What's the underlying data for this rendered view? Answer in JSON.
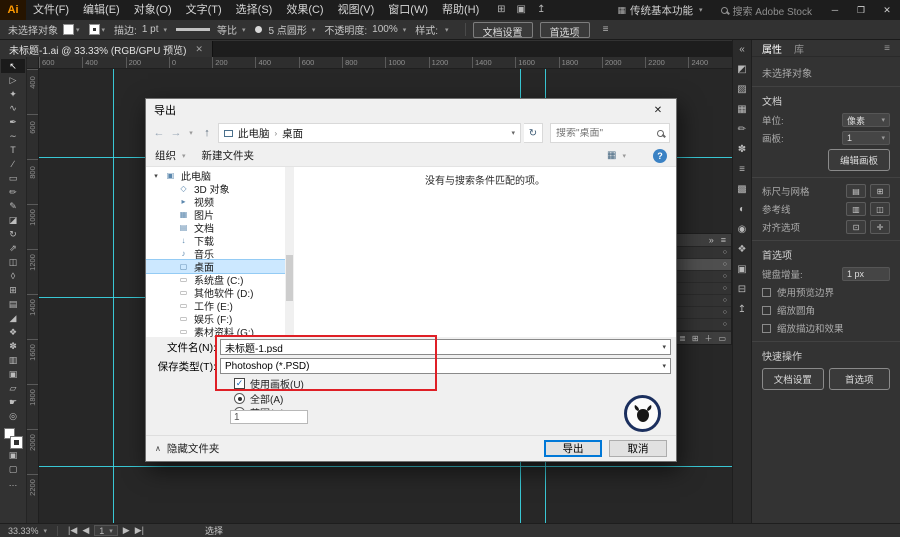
{
  "colors": {
    "accent": "#0078d7",
    "guide": "#3cd9e8",
    "annotation": "#df1f26"
  },
  "glyphs": {
    "caret": "▾",
    "hamburger": "≡",
    "back": "←",
    "forward": "→",
    "up": "↑",
    "refresh": "↻",
    "check": "✓",
    "chevron_up": "∧",
    "twisty": "▾",
    "double_right": "»",
    "circle": "○",
    "close": "✕",
    "question": "?",
    "view": "▦"
  },
  "menubar": {
    "logo": "Ai",
    "items": [
      {
        "name": "menu-file",
        "label": "文件(F)"
      },
      {
        "name": "menu-edit",
        "label": "编辑(E)"
      },
      {
        "name": "menu-object",
        "label": "对象(O)"
      },
      {
        "name": "menu-type",
        "label": "文字(T)"
      },
      {
        "name": "menu-select",
        "label": "选择(S)"
      },
      {
        "name": "menu-effect",
        "label": "效果(C)"
      },
      {
        "name": "menu-view",
        "label": "视图(V)"
      },
      {
        "name": "menu-window",
        "label": "窗口(W)"
      },
      {
        "name": "menu-help",
        "label": "帮助(H)"
      }
    ],
    "icons": [
      {
        "name": "arrange-documents-icon",
        "glyph": "⊞"
      },
      {
        "name": "document-layout-icon",
        "glyph": "▣"
      },
      {
        "name": "share-icon",
        "glyph": "↥"
      }
    ],
    "workspace_icon": "▦",
    "workspace_button": "传统基本功能",
    "search_text": "搜索 Adobe Stock",
    "window_controls": {
      "minimize": "─",
      "restore": "❐",
      "close": "✕"
    }
  },
  "control_bar": {
    "status_text": "未选择对象",
    "stroke_label": "描边:",
    "stroke_value": "1 pt",
    "profile_value": "等比",
    "brush_value": "5 点圆形",
    "opacity_label": "不透明度:",
    "opacity_value": "100%",
    "style_label": "样式:",
    "doc_setup_button": "文档设置",
    "preferences_button": "首选项"
  },
  "document_tab": {
    "title": "未标题-1.ai @ 33.33% (RGB/GPU 预览)",
    "close_glyph": "✕"
  },
  "tools": [
    {
      "name": "selection-tool",
      "glyph": "↖",
      "active": true
    },
    {
      "name": "direct-selection-tool",
      "glyph": "▷"
    },
    {
      "name": "magic-wand-tool",
      "glyph": "✦"
    },
    {
      "name": "lasso-tool",
      "glyph": "∿"
    },
    {
      "name": "pen-tool",
      "glyph": "✒"
    },
    {
      "name": "curvature-tool",
      "glyph": "∼"
    },
    {
      "name": "type-tool",
      "glyph": "T"
    },
    {
      "name": "line-segment-tool",
      "glyph": "∕"
    },
    {
      "name": "rectangle-tool",
      "glyph": "▭"
    },
    {
      "name": "paintbrush-tool",
      "glyph": "✏"
    },
    {
      "name": "pencil-tool",
      "glyph": "✎"
    },
    {
      "name": "eraser-tool",
      "glyph": "◪"
    },
    {
      "name": "rotate-tool",
      "glyph": "↻"
    },
    {
      "name": "scale-tool",
      "glyph": "⇗"
    },
    {
      "name": "shape-builder-tool",
      "glyph": "◫"
    },
    {
      "name": "perspective-grid-tool",
      "glyph": "◊"
    },
    {
      "name": "mesh-tool",
      "glyph": "⊞"
    },
    {
      "name": "gradient-tool",
      "glyph": "▤"
    },
    {
      "name": "eyedropper-tool",
      "glyph": "◢"
    },
    {
      "name": "blend-tool",
      "glyph": "❖"
    },
    {
      "name": "symbol-sprayer-tool",
      "glyph": "✽"
    },
    {
      "name": "column-graph-tool",
      "glyph": "▥"
    },
    {
      "name": "artboard-tool",
      "glyph": "▣"
    },
    {
      "name": "slice-tool",
      "glyph": "▱"
    },
    {
      "name": "hand-tool",
      "glyph": "☛"
    },
    {
      "name": "zoom-tool",
      "glyph": "◎"
    }
  ],
  "toolbar_bottom": [
    {
      "name": "drawing-mode-icon",
      "glyph": "▣"
    },
    {
      "name": "screen-mode-icon",
      "glyph": "▢"
    },
    {
      "name": "edit-toolbar-icon",
      "glyph": "…"
    }
  ],
  "rulers": {
    "horizontal": [
      "600",
      "400",
      "200",
      "0",
      "200",
      "400",
      "600",
      "800",
      "1000",
      "1200",
      "1400",
      "1600",
      "1800",
      "2000",
      "2200",
      "2400"
    ],
    "vertical": [
      "400",
      "600",
      "800",
      "1000",
      "1200",
      "1400",
      "1600",
      "1800",
      "2000",
      "2200"
    ]
  },
  "panel_strip": [
    {
      "name": "expand-panels-icon",
      "glyph": "«"
    },
    {
      "name": "color-panel-icon",
      "glyph": "◩"
    },
    {
      "name": "color-guide-panel-icon",
      "glyph": "▨"
    },
    {
      "name": "swatches-panel-icon",
      "glyph": "▦"
    },
    {
      "name": "brushes-panel-icon",
      "glyph": "✏"
    },
    {
      "name": "symbols-panel-icon",
      "glyph": "✽"
    },
    {
      "name": "stroke-panel-icon",
      "glyph": "≡"
    },
    {
      "name": "gradient-panel-icon",
      "glyph": "▩"
    },
    {
      "name": "transparency-panel-icon",
      "glyph": "◐"
    },
    {
      "name": "appearance-panel-icon",
      "glyph": "◉"
    },
    {
      "name": "graphic-styles-panel-icon",
      "glyph": "❖"
    },
    {
      "name": "layers-panel-icon",
      "glyph": "▣"
    },
    {
      "name": "artboards-panel-icon",
      "glyph": "⊟"
    },
    {
      "name": "asset-export-panel-icon",
      "glyph": "↥"
    }
  ],
  "float_panel": {
    "collapse_icon": "»",
    "menu_icon": "≡",
    "rows": [
      {
        "name": "panel-row",
        "target": "○"
      },
      {
        "name": "panel-row",
        "target": "○",
        "selected": true
      },
      {
        "name": "panel-row",
        "target": "○"
      },
      {
        "name": "panel-row",
        "target": "○"
      },
      {
        "name": "panel-row",
        "target": "○"
      },
      {
        "name": "panel-row",
        "target": "○"
      },
      {
        "name": "panel-row",
        "target": "○"
      }
    ],
    "footer_icons": [
      {
        "name": "panel-options-icon",
        "glyph": "≣"
      },
      {
        "name": "new-item-icon",
        "glyph": "⊞"
      },
      {
        "name": "add-icon",
        "glyph": "＋"
      },
      {
        "name": "delete-icon",
        "glyph": "▭"
      }
    ]
  },
  "properties": {
    "tab_properties": "属性",
    "tab_libraries": "库",
    "no_selection": "未选择对象",
    "document": {
      "section": "文档",
      "unit_label": "单位:",
      "unit_value": "像素",
      "artboard_label": "画板:",
      "artboard_value": "1",
      "edit_artboards": "编辑画板"
    },
    "icon_rows": [
      {
        "name": "ruler-grid-row",
        "label": "标尺与网格",
        "icon1": "▤",
        "icon2": "⊞"
      },
      {
        "name": "guides-row",
        "label": "参考线",
        "icon1": "▥",
        "icon2": "◫"
      },
      {
        "name": "snap-options-row",
        "label": "对齐选项",
        "icon1": "⊡",
        "icon2": "✛"
      }
    ],
    "preferences": {
      "section": "首选项",
      "key_increment_label": "键盘增量:",
      "key_increment_value": "1 px",
      "checkboxes": [
        {
          "name": "use-preview-bounds-checkbox",
          "label": "使用预览边界"
        },
        {
          "name": "scale-corners-checkbox",
          "label": "缩放圆角"
        },
        {
          "name": "scale-strokes-effects-checkbox",
          "label": "缩放描边和效果"
        }
      ]
    },
    "quick_actions": {
      "section": "快速操作",
      "buttons": [
        {
          "name": "document-setup-button",
          "label": "文档设置"
        },
        {
          "name": "preferences-button",
          "label": "首选项"
        }
      ]
    }
  },
  "dialog": {
    "title": "导出",
    "breadcrumb": {
      "root": "此电脑",
      "separator": "›",
      "current": "桌面"
    },
    "search_placeholder": "搜索\"桌面\"",
    "organize": "组织",
    "new_folder": "新建文件夹",
    "empty_message": "没有与搜索条件匹配的项。",
    "tree": [
      {
        "name": "tree-this-pc",
        "label": "此电脑",
        "icon": "▣",
        "indent": 0,
        "twisty": "▾"
      },
      {
        "name": "tree-3d-objects",
        "label": "3D 对象",
        "icon": "◇",
        "indent": 1
      },
      {
        "name": "tree-videos",
        "label": "视频",
        "icon": "▸",
        "indent": 1
      },
      {
        "name": "tree-pictures",
        "label": "图片",
        "icon": "▦",
        "indent": 1
      },
      {
        "name": "tree-documents",
        "label": "文档",
        "icon": "▤",
        "indent": 1
      },
      {
        "name": "tree-downloads",
        "label": "下载",
        "icon": "↓",
        "indent": 1
      },
      {
        "name": "tree-music",
        "label": "音乐",
        "icon": "♪",
        "indent": 1
      },
      {
        "name": "tree-desktop",
        "label": "桌面",
        "icon": "▢",
        "indent": 1,
        "selected": true
      },
      {
        "name": "tree-drive-c",
        "label": "系统盘 (C:)",
        "icon": "▭",
        "indent": 1,
        "kind": "drive"
      },
      {
        "name": "tree-drive-d",
        "label": "其他软件 (D:)",
        "icon": "▭",
        "indent": 1,
        "kind": "drive"
      },
      {
        "name": "tree-drive-e",
        "label": "工作 (E:)",
        "icon": "▭",
        "indent": 1,
        "kind": "drive"
      },
      {
        "name": "tree-drive-f",
        "label": "娱乐 (F:)",
        "icon": "▭",
        "indent": 1,
        "kind": "drive"
      },
      {
        "name": "tree-drive-g",
        "label": "素材资料 (G:)",
        "icon": "▭",
        "indent": 1,
        "kind": "drive"
      }
    ],
    "form": {
      "filename_label": "文件名(N):",
      "filename_value": "未标题-1.psd",
      "filetype_label": "保存类型(T):",
      "filetype_value": "Photoshop (*.PSD)",
      "use_artboards_label": "使用画板(U)",
      "all_label": "全部(A)",
      "range_label": "范围(G):",
      "range_value": "1"
    },
    "hide_folders_label": "隐藏文件夹",
    "export_button": "导出",
    "cancel_button": "取消"
  },
  "status_bar": {
    "zoom_value": "33.33%",
    "first_icon": "|◀",
    "prev_icon": "◀",
    "artboard_value": "1",
    "next_icon": "▶",
    "last_icon": "▶|",
    "tool_label": "选择"
  }
}
